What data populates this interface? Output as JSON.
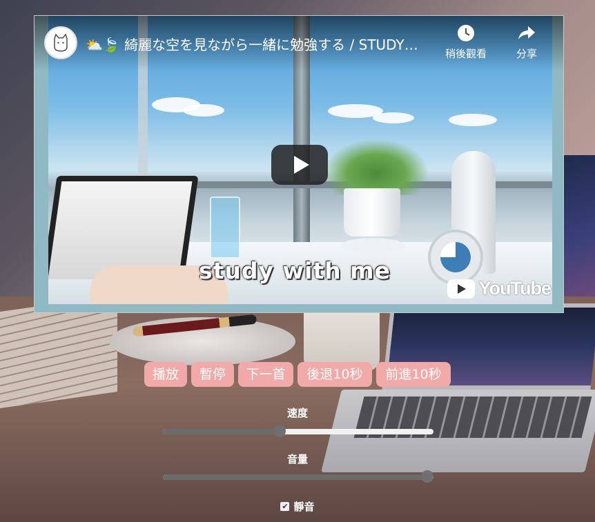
{
  "video": {
    "title": "綺麗な空を見ながら一緒に勉強する / STUDY…",
    "title_emoji": "⛅🍃",
    "overlay_text": "study with me",
    "watch_later_label": "稍後觀看",
    "share_label": "分享",
    "brand_label": "YouTube"
  },
  "controls": {
    "play": "播放",
    "pause": "暫停",
    "next": "下一首",
    "rewind": "後退10秒",
    "forward": "前進10秒"
  },
  "speed": {
    "label": "速度",
    "value": 0.43
  },
  "volume": {
    "label": "音量",
    "value": 1.0
  },
  "mute": {
    "label": "靜音",
    "checked": true
  }
}
